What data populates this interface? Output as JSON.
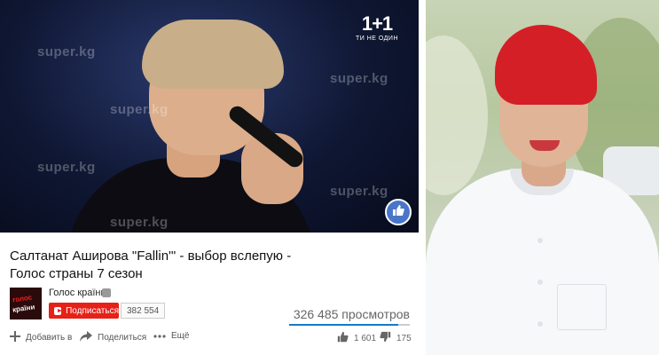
{
  "video": {
    "watermark": "super.kg",
    "channel_logo": {
      "primary": "1+1",
      "tagline": "ТИ НЕ ОДИН"
    }
  },
  "info": {
    "title_line1": "Салтанат Аширова \"Fallin'\" - выбор вслепую -",
    "title_line2": "Голос страны 7 сезон",
    "channel": {
      "name": "Голос країни",
      "avatar_text_1": "голос",
      "avatar_text_2": "країни"
    },
    "subscribe_label": "Подписаться",
    "subscriber_count": "382 554",
    "views": "326 485 просмотров",
    "like_ratio": 0.9017,
    "actions": {
      "add_to": "Добавить в",
      "share": "Поделиться",
      "more": "Ещё"
    },
    "likes": "1 601",
    "dislikes": "175"
  },
  "colors": {
    "subscribe_red": "#e62117",
    "sentiment_blue": "#167ac6",
    "like_fab_blue": "#4a76c9",
    "hair_red": "#d41f27"
  },
  "icons": {
    "add_to": "plus-icon",
    "share": "share-arrow-icon",
    "more": "more-dots-icon",
    "like": "thumbs-up-icon",
    "dislike": "thumbs-down-icon",
    "verified": "verified-icon"
  }
}
